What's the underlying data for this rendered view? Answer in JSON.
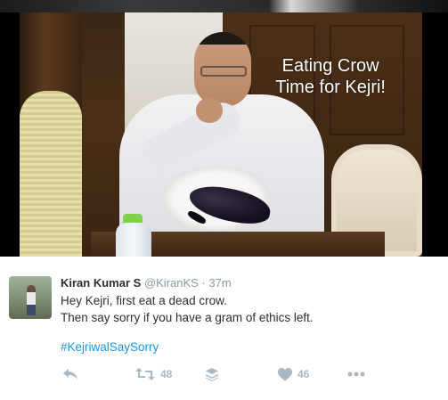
{
  "image": {
    "caption_line1": "Eating Crow",
    "caption_line2": "Time for Kejri!"
  },
  "tweet": {
    "name": "Kiran Kumar S",
    "handle": "@KiranKS",
    "separator": "·",
    "time": "37m",
    "text_line1": "Hey Kejri, first eat a dead crow.",
    "text_line2": "Then say sorry if you have a gram of ethics left.",
    "hashtag": "#KejriwalSaySorry"
  },
  "actions": {
    "reply_icon": "reply-icon",
    "retweet_icon": "retweet-icon",
    "retweet_count": "48",
    "buffer_icon": "stack-icon",
    "like_icon": "heart-icon",
    "like_count": "46",
    "more_icon": "more-icon"
  },
  "colors": {
    "link": "#1b95e0",
    "name": "#292f33",
    "muted": "#8899a6",
    "action": "#aab8c2"
  }
}
